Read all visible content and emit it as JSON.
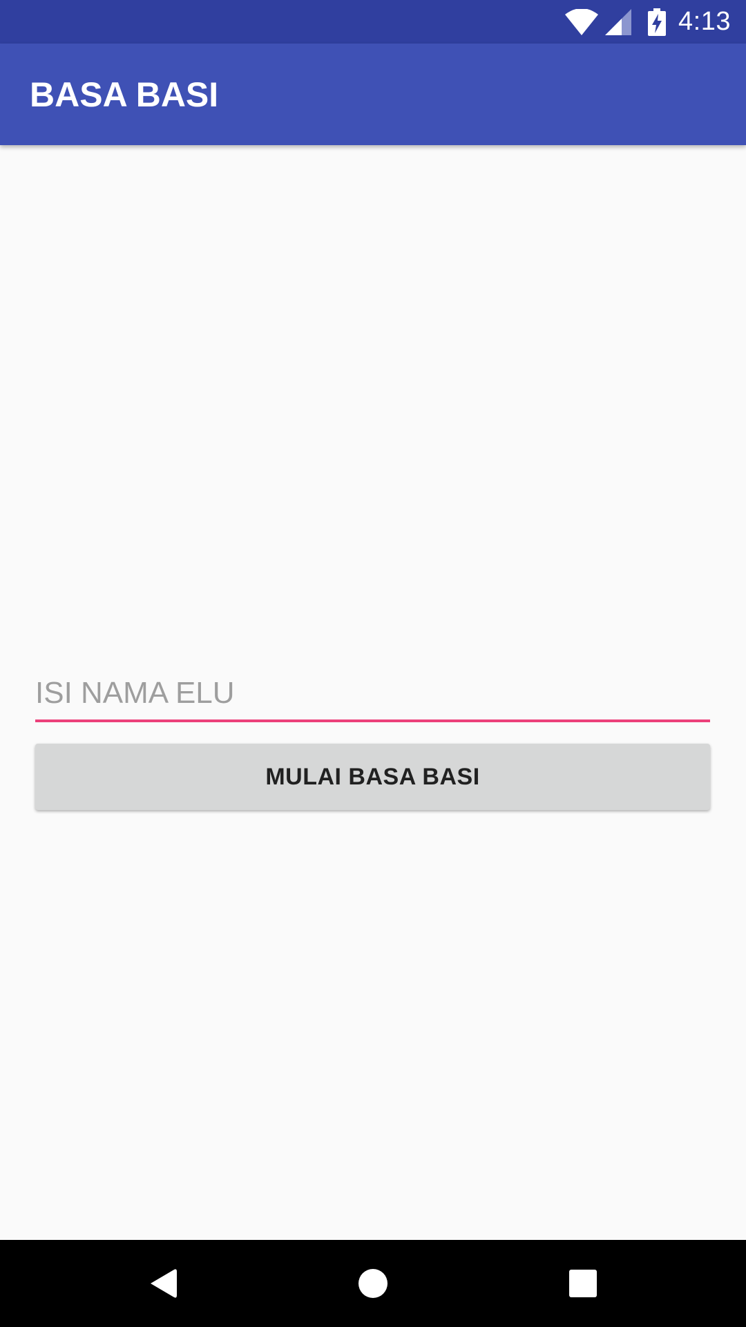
{
  "status_bar": {
    "time": "4:13",
    "icons": [
      "wifi-icon",
      "cell-signal-icon",
      "battery-charging-icon"
    ]
  },
  "app_bar": {
    "title": "BASA BASI"
  },
  "form": {
    "name_input": {
      "value": "",
      "placeholder": "ISI NAMA ELU"
    },
    "start_button_label": "MULAI BASA BASI"
  },
  "nav_bar": {
    "icons": [
      "back-icon",
      "home-icon",
      "recents-icon"
    ]
  },
  "colors": {
    "status_bar": "#303f9f",
    "app_bar": "#3f51b5",
    "accent": "#ec407a",
    "button": "#d6d7d7",
    "background": "#fafafa"
  }
}
